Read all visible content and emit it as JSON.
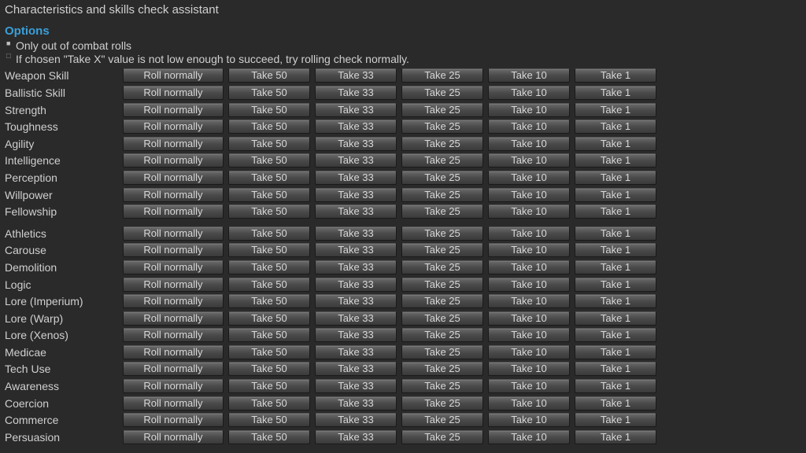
{
  "title": "Characteristics and skills check assistant",
  "options": {
    "header": "Options",
    "opt1": "Only out of combat rolls",
    "opt2": "If chosen \"Take X\" value is not low enough to succeed, try rolling check normally."
  },
  "buttons": {
    "roll": "Roll normally",
    "t50": "Take 50",
    "t33": "Take 33",
    "t25": "Take 25",
    "t10": "Take 10",
    "t1": "Take 1"
  },
  "characteristics": [
    "Weapon Skill",
    "Ballistic Skill",
    "Strength",
    "Toughness",
    "Agility",
    "Intelligence",
    "Perception",
    "Willpower",
    "Fellowship"
  ],
  "skills": [
    "Athletics",
    "Carouse",
    "Demolition",
    "Logic",
    "Lore (Imperium)",
    "Lore (Warp)",
    "Lore (Xenos)",
    "Medicae",
    "Tech Use",
    "Awareness",
    "Coercion",
    "Commerce",
    "Persuasion"
  ]
}
